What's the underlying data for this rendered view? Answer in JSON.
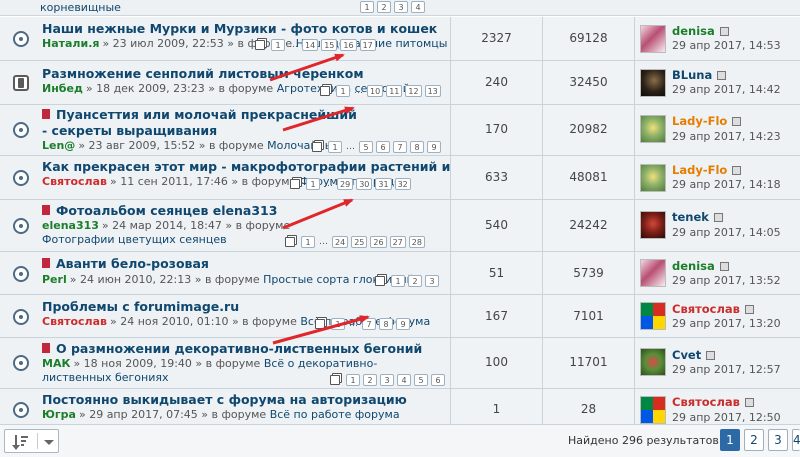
{
  "top_fragment": {
    "text": "корневищные",
    "pages": [
      "1",
      "2",
      "3",
      "4"
    ]
  },
  "topics": [
    {
      "title": "Наши нежные Мурки и Мурзики - фото котов и кошек",
      "hot": false,
      "sticky": false,
      "author": "Натали.я",
      "date": "» 23 июл 2009, 22:53 »",
      "forum_prefix": "в форуме",
      "forum": "Наши домашние питомцы",
      "pages": [
        "1",
        "…",
        "14",
        "15",
        "16",
        "17"
      ],
      "replies": "2327",
      "views": "69128",
      "last_user": "denisa",
      "last_date": "29 апр 2017, 14:53"
    },
    {
      "title": "Размножение сенполий листовым черенком",
      "hot": false,
      "sticky": true,
      "author": "Инбед",
      "date": "» 18 дек 2009, 23:23 »",
      "forum_prefix": "в форуме",
      "forum": "Агротехника сенполий",
      "pages": [
        "1",
        "…",
        "10",
        "11",
        "12",
        "13"
      ],
      "replies": "240",
      "views": "32450",
      "last_user": "BLuna",
      "last_date": "29 апр 2017, 14:42"
    },
    {
      "title": "Пуансеттия или молочай прекраснейший - секреты выращивания",
      "hot": true,
      "sticky": false,
      "author": "Len@",
      "date": "» 23 авг 2009, 15:52 »",
      "forum_prefix": "в форуме",
      "forum": "Молочайные",
      "pages": [
        "1",
        "…",
        "5",
        "6",
        "7",
        "8",
        "9"
      ],
      "replies": "170",
      "views": "20982",
      "last_user": "Lady-Flo",
      "last_date": "29 апр 2017, 14:23"
    },
    {
      "title": "Как прекрасен этот мир - макрофотографии растений и цветов",
      "hot": false,
      "sticky": false,
      "author": "Святослав",
      "date": "» 11 сен 2011, 17:46 »",
      "forum_prefix": "в форуме",
      "forum": "Форум о природе",
      "pages": [
        "1",
        "…",
        "29",
        "30",
        "31",
        "32"
      ],
      "replies": "633",
      "views": "48081",
      "last_user": "Lady-Flo",
      "last_date": "29 апр 2017, 14:18"
    },
    {
      "title": "Фотоальбом сеянцев elena313",
      "hot": true,
      "sticky": false,
      "author": "elena313",
      "date": "» 24 мар 2014, 18:47 »",
      "forum_prefix": "в форуме",
      "forum": "Фотографии цветущих сеянцев",
      "pages": [
        "1",
        "…",
        "24",
        "25",
        "26",
        "27",
        "28"
      ],
      "replies": "540",
      "views": "24242",
      "last_user": "tenek",
      "last_date": "29 апр 2017, 14:05"
    },
    {
      "title": "Аванти бело-розовая",
      "hot": true,
      "sticky": false,
      "author": "Perl",
      "date": "» 24 июн 2010, 22:13 »",
      "forum_prefix": "в форуме",
      "forum": "Простые сорта глоксиний",
      "pages": [
        "1",
        "2",
        "3"
      ],
      "replies": "51",
      "views": "5739",
      "last_user": "denisa",
      "last_date": "29 апр 2017, 13:52"
    },
    {
      "title": "Проблемы с forumimage.ru",
      "hot": false,
      "sticky": false,
      "author": "Святослав",
      "date": "» 24 ноя 2010, 01:10 »",
      "forum_prefix": "в форуме",
      "forum": "Всё по работе форума",
      "pages": [
        "1",
        "…",
        "7",
        "8",
        "9"
      ],
      "replies": "167",
      "views": "7101",
      "last_user": "Святослав",
      "last_date": "29 апр 2017, 13:20"
    },
    {
      "title": "О размножении декоративно-лиственных бегоний",
      "hot": true,
      "sticky": false,
      "author": "МАК",
      "date": "» 18 ноя 2009, 19:40 »",
      "forum_prefix": "в форуме",
      "forum": "Всё о декоративно-лиственных бегониях",
      "pages": [
        "1",
        "2",
        "3",
        "4",
        "5",
        "6"
      ],
      "replies": "100",
      "views": "11701",
      "last_user": "Cvet",
      "last_date": "29 апр 2017, 12:57"
    },
    {
      "title": "Постоянно выкидывает с форума на авторизацию",
      "hot": false,
      "sticky": false,
      "author": "Югра",
      "date": "» 29 апр 2017, 07:45 »",
      "forum_prefix": "в форуме",
      "forum": "Всё по работе форума",
      "pages": [],
      "replies": "1",
      "views": "28",
      "last_user": "Святослав",
      "last_date": "29 апр 2017, 12:50"
    }
  ],
  "footer": {
    "results": "Найдено 296 результатов",
    "pages": [
      "1",
      "2",
      "3",
      "4"
    ]
  },
  "icons": {
    "status": "topic-read-icon",
    "sticky": "sticky-topic-icon",
    "hot": "hot-topic-icon",
    "goto_last": "goto-last-post-icon",
    "pagination": "pages-icon",
    "sort": "sort-options-icon"
  },
  "colors": {
    "link": "#10476e",
    "author_green": "#1c7e2a",
    "author_red": "#cc2c2c",
    "user_orange": "#e67c00",
    "arrow_red": "#e0262a",
    "active_page": "#2d6aa5"
  }
}
